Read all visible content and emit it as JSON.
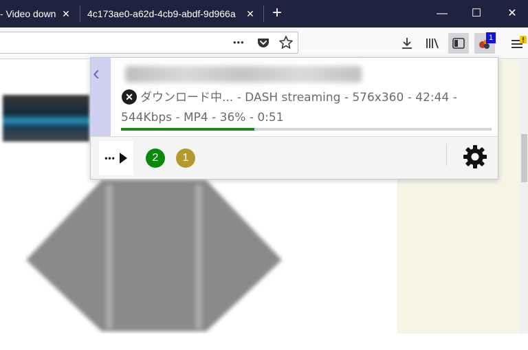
{
  "tabs": [
    {
      "title": "- Video down",
      "close": "✕"
    },
    {
      "title": "4c173ae0-a62d-4cb9-abdf-9d966a",
      "close": "✕"
    }
  ],
  "new_tab": "+",
  "window_controls": {
    "minimize": "—",
    "maximize": "☐",
    "close": "✕"
  },
  "urlbar": {
    "more": "•••"
  },
  "extension": {
    "badge_count": "1"
  },
  "popup": {
    "back": "‹",
    "close_symbol": "✕",
    "status_line1": "ダウンロード中... - DASH streaming - 576x360 - 42:44 -",
    "status_line2": "544Kbps - MP4 - 36% - 0:51",
    "progress": 0.36,
    "more_label": "•••",
    "badge_green": "2",
    "badge_gold": "1",
    "colors": {
      "progress": "#1e8a1e",
      "badge_green": "#0a8a0a",
      "badge_gold": "#b39a2e",
      "sidebar": "#d0d0f0"
    }
  }
}
